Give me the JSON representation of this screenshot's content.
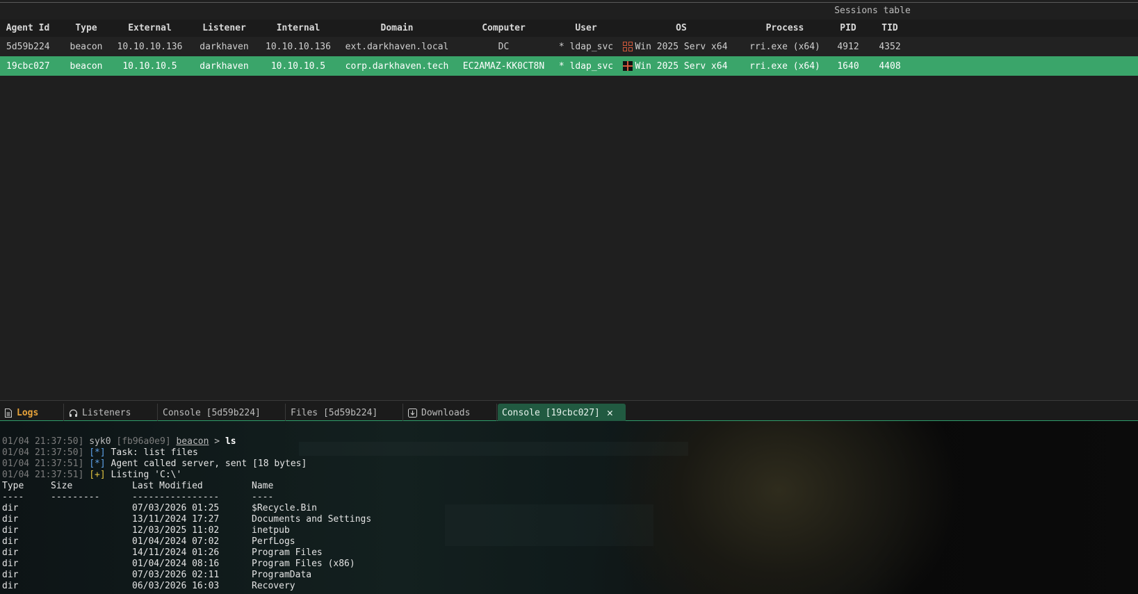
{
  "sessions_title": "Sessions table",
  "columns": [
    "Agent Id",
    "Type",
    "External",
    "Listener",
    "Internal",
    "Domain",
    "Computer",
    "User",
    "OS",
    "Process",
    "PID",
    "TID"
  ],
  "rows": [
    {
      "agent_id": "5d59b224",
      "type": "beacon",
      "external": "10.10.10.136",
      "listener": "darkhaven",
      "internal": "10.10.10.136",
      "domain": "ext.darkhaven.local",
      "computer": "DC",
      "user": "* ldap_svc",
      "os_icon": "windows-icon",
      "os": "Win 2025 Serv x64",
      "process": "rri.exe (x64)",
      "pid": "4912",
      "tid": "4352"
    },
    {
      "agent_id": "19cbc027",
      "type": "beacon",
      "external": "10.10.10.5",
      "listener": "darkhaven",
      "internal": "10.10.10.5",
      "domain": "corp.darkhaven.tech",
      "computer": "EC2AMAZ-KK0CT8N",
      "user": "* ldap_svc",
      "os_icon": "windows-icon",
      "os": "Win 2025 Serv x64",
      "process": "rri.exe (x64)",
      "pid": "1640",
      "tid": "4408"
    }
  ],
  "tabs": [
    {
      "label": "Logs",
      "icon": "document-icon"
    },
    {
      "label": "Listeners",
      "icon": "headphones-icon"
    },
    {
      "label": "Console [5d59b224]"
    },
    {
      "label": "Files [5d59b224]"
    },
    {
      "label": "Downloads",
      "icon": "download-icon"
    },
    {
      "label": "Console [19cbc027]",
      "close": "close-icon"
    }
  ],
  "console": {
    "lines": [
      {
        "ts": "01/04 21:37:50]",
        "user": "syk0",
        "hash": "[fb96a0e9]",
        "agent": "beacon",
        "gt": ">",
        "cmd": "ls"
      },
      {
        "ts": "01/04 21:37:50]",
        "mark": "[*]",
        "text": "Task: list files"
      },
      {
        "ts": "01/04 21:37:51]",
        "mark": "[*]",
        "text": "Agent called server, sent [18 bytes]"
      },
      {
        "ts": "01/04 21:37:51]",
        "mark": "[+]",
        "text": "Listing 'C:\\'"
      }
    ],
    "listing_headers": [
      "Type",
      "Size",
      "Last Modified",
      "Name"
    ],
    "listing_sep": [
      "----",
      "---------",
      "----------------",
      "----"
    ],
    "listing": [
      {
        "type": "dir",
        "size": "",
        "modified": "07/03/2026 01:25",
        "name": "$Recycle.Bin"
      },
      {
        "type": "dir",
        "size": "",
        "modified": "13/11/2024 17:27",
        "name": "Documents and Settings"
      },
      {
        "type": "dir",
        "size": "",
        "modified": "12/03/2025 11:02",
        "name": "inetpub"
      },
      {
        "type": "dir",
        "size": "",
        "modified": "01/04/2024 07:02",
        "name": "PerfLogs"
      },
      {
        "type": "dir",
        "size": "",
        "modified": "14/11/2024 01:26",
        "name": "Program Files"
      },
      {
        "type": "dir",
        "size": "",
        "modified": "01/04/2024 08:16",
        "name": "Program Files (x86)"
      },
      {
        "type": "dir",
        "size": "",
        "modified": "07/03/2026 02:11",
        "name": "ProgramData"
      },
      {
        "type": "dir",
        "size": "",
        "modified": "06/03/2026 16:03",
        "name": "Recovery"
      }
    ]
  },
  "colors": {
    "accent": "#3aa56a",
    "tab_active": "#215a41",
    "log_tab": "#e8a33a",
    "warn_icon": "#d35a3c"
  }
}
